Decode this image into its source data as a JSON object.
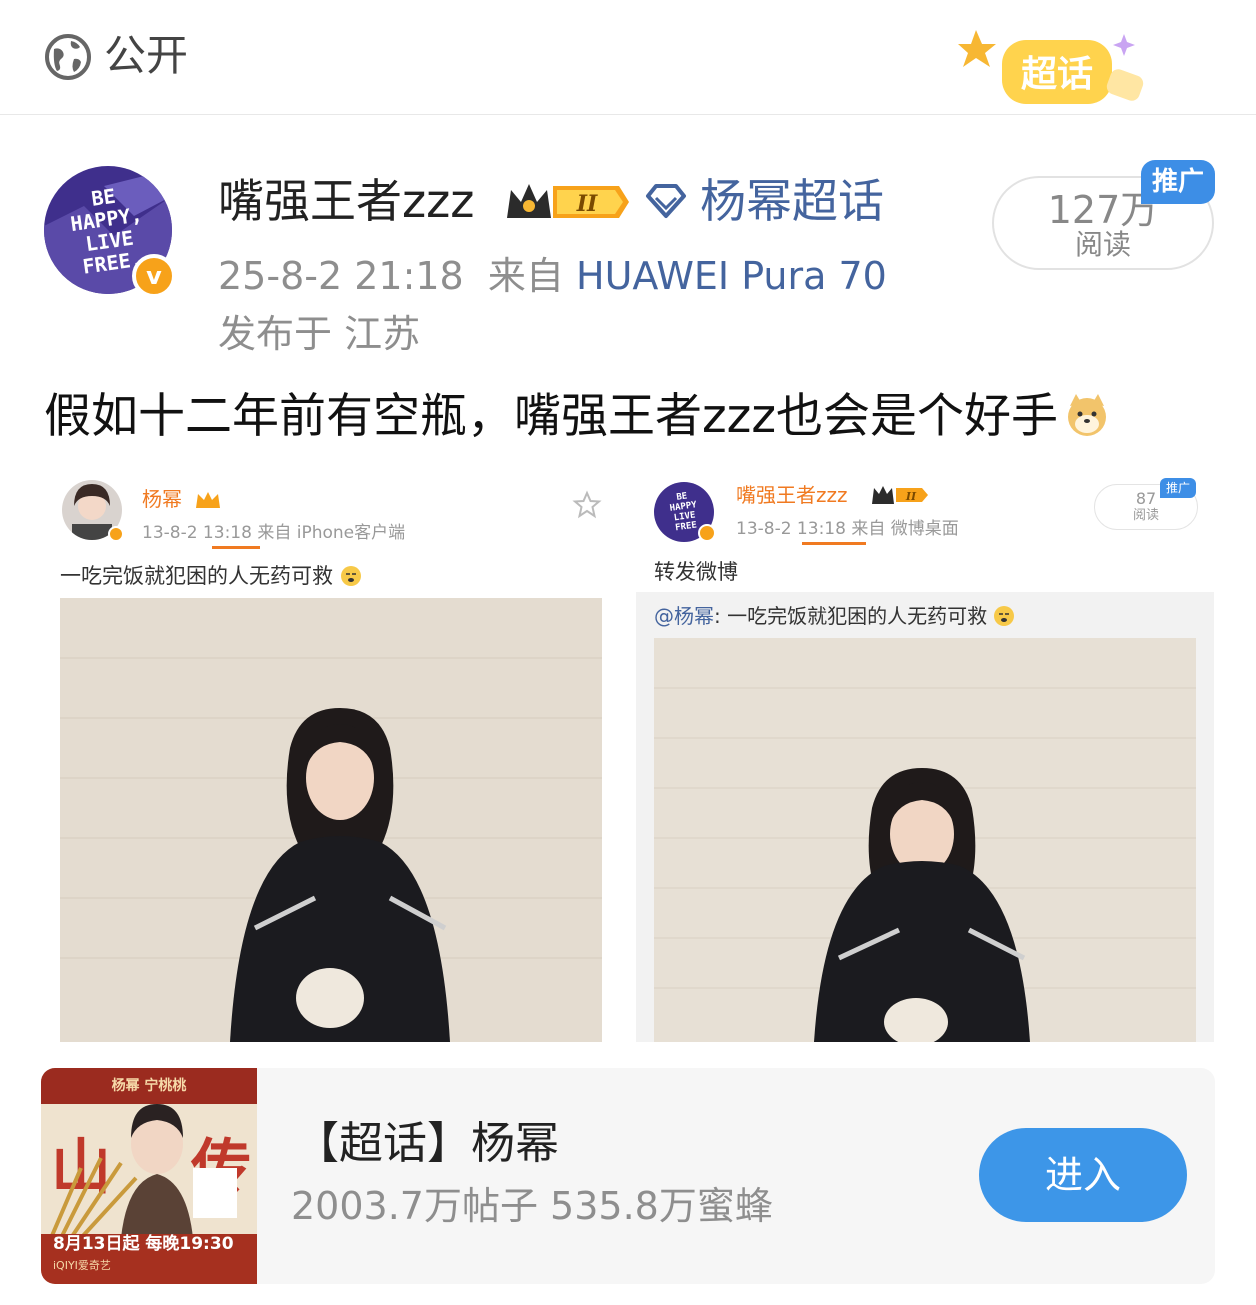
{
  "topbar": {
    "visibility_icon": "globe-icon",
    "visibility_label": "公开",
    "badge_label": "超话"
  },
  "post": {
    "avatar_lines": [
      "BE",
      "HAPPY,",
      "LIVE",
      "FREE."
    ],
    "verified_mark": "v",
    "username": "嘴强王者zzz",
    "level_badge": "II",
    "topic_link": "杨幂超话",
    "timestamp": "25-8-2 21:18",
    "source_prefix": "来自",
    "device": "HUAWEI Pura 70",
    "location": "发布于 江苏",
    "reads_count": "127万",
    "reads_label": "阅读",
    "promo_tag": "推广",
    "text": "假如十二年前有空瓶，嘴强王者zzz也会是个好手"
  },
  "left_shot": {
    "name": "杨幂",
    "meta": "13-8-2 13:18  来自 iPhone客户端",
    "text": "一吃完饭就犯困的人无药可救"
  },
  "right_shot": {
    "avatar_lines": [
      "BE",
      "HAPPY",
      "LIVE",
      "FREE"
    ],
    "name": "嘴强王者zzz",
    "level_badge": "II",
    "meta": "13-8-2 13:18  来自 微博桌面",
    "reads_count": "87",
    "reads_label": "阅读",
    "promo_tag": "推广",
    "text": "转发微博",
    "repost_at": "@杨幂",
    "repost_text": ": 一吃完饭就犯困的人无药可救"
  },
  "topic_card": {
    "poster_title": "杨幂  宁桃桃",
    "poster_date": "8月13日起 每晚19:30",
    "poster_sub": "iQIYI爱奇艺",
    "title": "【超话】杨幂",
    "stats": "2003.7万帖子 535.8万蜜蜂",
    "enter_label": "进入"
  },
  "colors": {
    "link_blue": "#44649e",
    "button_blue": "#3d96e8",
    "promo_blue": "#3d8ee6",
    "gray_text": "#8e8e8e",
    "orange": "#f07a21"
  }
}
